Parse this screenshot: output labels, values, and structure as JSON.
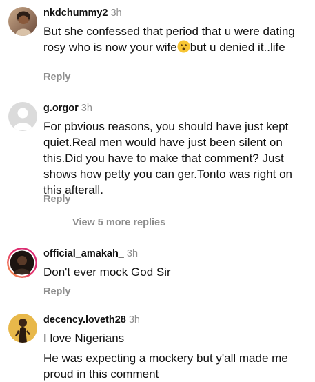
{
  "comments": [
    {
      "username": "nkdchummy2",
      "time": "3h",
      "text_before_emoji": "But she confessed that period that u were dating rosy who is now your wife",
      "emoji": "astonished-face-emoji",
      "text_after_emoji": "but u denied it..life",
      "reply": "Reply"
    },
    {
      "username": "g.orgor",
      "time": "3h",
      "text": "For pbvious reasons, you should have just kept quiet.Real men would have just been silent on this.Did you have to make that comment? Just shows how petty you can ger.Tonto was right on this afterall.",
      "reply": "Reply",
      "more_replies": "View 5 more replies"
    },
    {
      "username": "official_amakah_",
      "time": "3h",
      "text": "Don't ever mock God Sir",
      "reply": "Reply"
    },
    {
      "username": "decency.loveth28",
      "time": "3h",
      "text": "I love Nigerians",
      "text2": "He was expecting a mockery but y'all made me proud in this comment"
    }
  ],
  "colors": {
    "username": "#111111",
    "muted": "#8e8e8e",
    "story_ring_start": "#f9a03f",
    "story_ring_end": "#d62976"
  },
  "icons": {
    "default_avatar": "default-avatar-icon"
  }
}
